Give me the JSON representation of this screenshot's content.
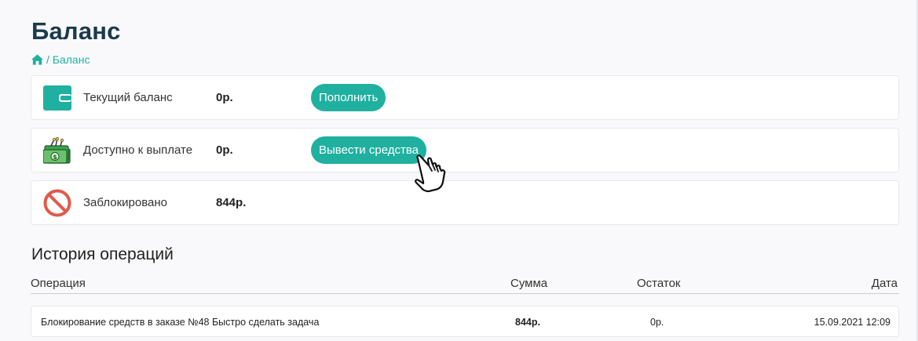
{
  "page": {
    "title": "Баланс",
    "breadcrumb": "/ Баланс"
  },
  "cards": [
    {
      "label": "Текущий баланс",
      "amount": "0р.",
      "button": "Пополнить",
      "icon": "wallet-icon"
    },
    {
      "label": "Доступно к выплате",
      "amount": "0р.",
      "button": "Вывести средства",
      "icon": "money-stack-icon"
    },
    {
      "label": "Заблокировано",
      "amount": "844р.",
      "icon": "blocked-icon"
    }
  ],
  "history": {
    "title": "История операций",
    "columns": [
      "Операция",
      "Сумма",
      "Остаток",
      "Дата"
    ],
    "rows": [
      {
        "operation": "Блокирование средств в заказе №48 Быстро сделать задача",
        "sum": "844р.",
        "balance": "0р.",
        "date": "15.09.2021 12:09"
      }
    ]
  },
  "colors": {
    "accent": "#1fb0a0",
    "title": "#1b3a4b",
    "blocked": "#e05a4a"
  }
}
